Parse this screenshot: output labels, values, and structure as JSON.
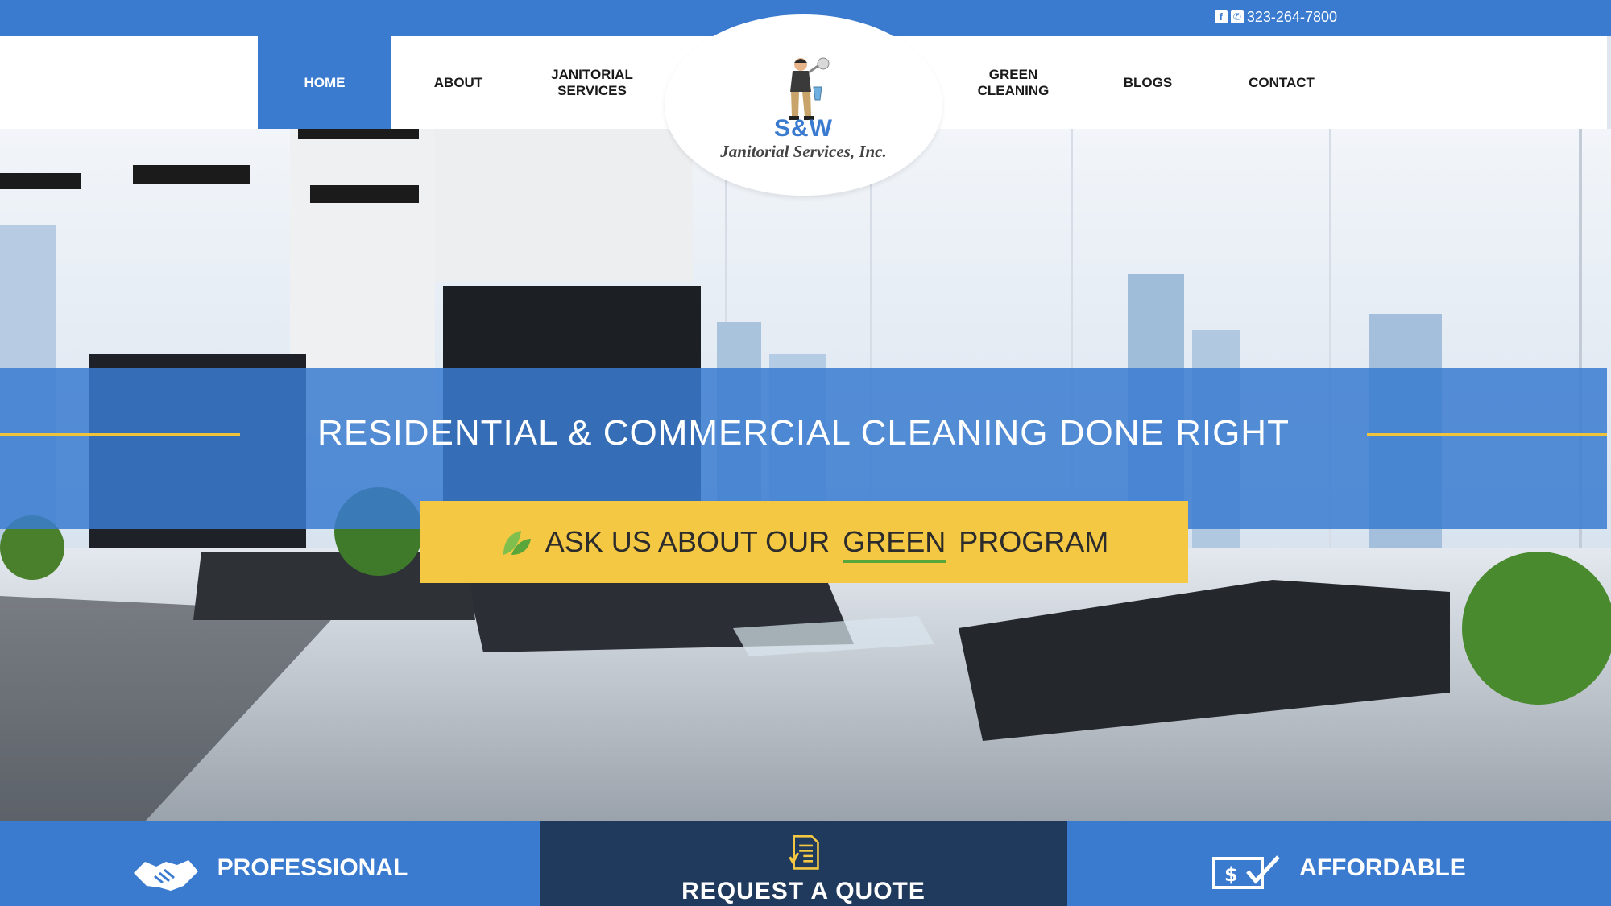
{
  "topbar": {
    "phone": "323-264-7800",
    "facebook_icon": "facebook-icon",
    "phone_icon": "phone-icon"
  },
  "nav": {
    "items": [
      {
        "label": "HOME",
        "active": true
      },
      {
        "label": "ABOUT",
        "active": false
      },
      {
        "label": "JANITORIAL\nSERVICES",
        "active": false
      },
      {
        "label": "GREEN\nCLEANING",
        "active": false
      },
      {
        "label": "BLOGS",
        "active": false
      },
      {
        "label": "CONTACT",
        "active": false
      }
    ]
  },
  "logo": {
    "brand": "S&W",
    "company": "Janitorial Services, Inc."
  },
  "hero": {
    "headline": "RESIDENTIAL & COMMERCIAL CLEANING DONE RIGHT",
    "cta": {
      "prefix": "ASK US ABOUT OUR",
      "highlight": "GREEN",
      "suffix": "PROGRAM",
      "icon": "leaf-icon"
    }
  },
  "features": {
    "professional": {
      "label": "PROFESSIONAL",
      "icon": "handshake-icon"
    },
    "quote": {
      "label": "REQUEST A QUOTE",
      "icon": "document-check-icon"
    },
    "affordable": {
      "label": "AFFORDABLE",
      "icon": "dollar-check-icon"
    }
  },
  "colors": {
    "brand_blue": "#3a7bd0",
    "navy": "#1f3a5c",
    "accent_yellow": "#f4c842",
    "line_yellow": "#f0c43a",
    "leaf_green": "#5aa63a"
  }
}
